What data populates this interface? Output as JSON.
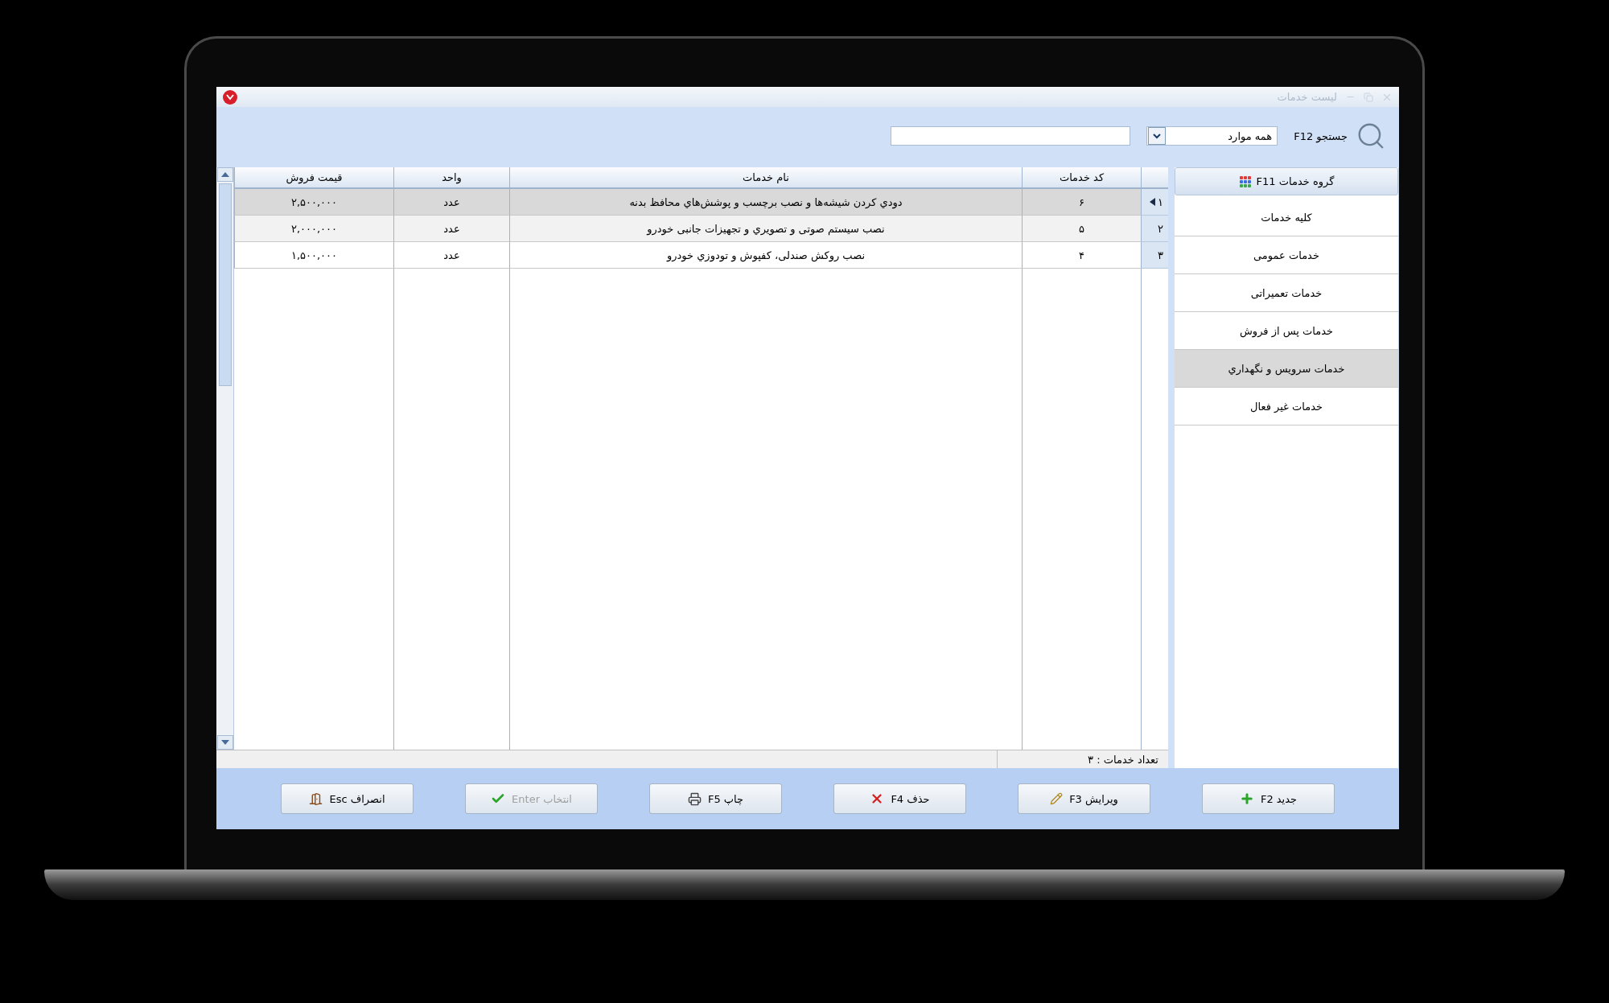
{
  "window": {
    "title": "لیست خدمات"
  },
  "search": {
    "label": "جستجو F12",
    "filter": "همه موارد"
  },
  "sidebar": {
    "title": "گروه خدمات F11",
    "items": [
      {
        "label": "کلیه خدمات",
        "selected": false
      },
      {
        "label": "خدمات عمومی",
        "selected": false
      },
      {
        "label": "خدمات تعمیراتی",
        "selected": false
      },
      {
        "label": "خدمات پس از فروش",
        "selected": false
      },
      {
        "label": "خدمات سرویس و نگهداري",
        "selected": true
      },
      {
        "label": "خدمات غیر فعال",
        "selected": false
      }
    ]
  },
  "table": {
    "columns": [
      "کد خدمات",
      "نام خدمات",
      "واحد",
      "قیمت فروش"
    ],
    "rows": [
      {
        "number": "۱",
        "code": "۶",
        "name": "دودي کردن شیشه‌ها و نصب برچسب و پوشش‌هاي محافظ بدنه",
        "unit": "عدد",
        "price": "۲,۵۰۰,۰۰۰",
        "selected": true
      },
      {
        "number": "۲",
        "code": "۵",
        "name": "نصب سیستم صوتی و تصویري و تجهیزات جانبی خودرو",
        "unit": "عدد",
        "price": "۲,۰۰۰,۰۰۰",
        "selected": false
      },
      {
        "number": "۳",
        "code": "۴",
        "name": "نصب روکش صندلی، کفپوش و تودوزي خودرو",
        "unit": "عدد",
        "price": "۱,۵۰۰,۰۰۰",
        "selected": false
      }
    ]
  },
  "status_bar": "تعداد خدمات : ۳",
  "buttons": [
    {
      "label": "جدید F2",
      "kind": "new",
      "disabled": false
    },
    {
      "label": "ویرایش F3",
      "kind": "edit",
      "disabled": false
    },
    {
      "label": "حذف F4",
      "kind": "delete",
      "disabled": false
    },
    {
      "label": "چاپ F5",
      "kind": "print",
      "disabled": false
    },
    {
      "label": "انتخاب Enter",
      "kind": "select",
      "disabled": true
    },
    {
      "label": "انصراف Esc",
      "kind": "cancel",
      "disabled": false
    }
  ]
}
